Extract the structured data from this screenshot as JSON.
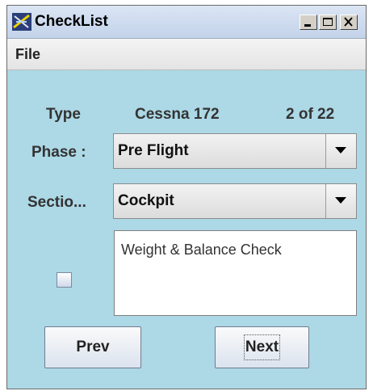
{
  "window": {
    "title": "CheckList",
    "controls": {
      "minimize": "minimize-icon",
      "maximize": "maximize-icon",
      "close": "close-icon"
    }
  },
  "menu": {
    "file": "File"
  },
  "header": {
    "type_label": "Type",
    "aircraft": "Cessna 172",
    "position": "2 of 22"
  },
  "phase": {
    "label": "Phase :",
    "selected": "Pre Flight"
  },
  "section": {
    "label": "Sectio...",
    "selected": "Cockpit"
  },
  "item": {
    "checked": false,
    "text": "Weight & Balance Check"
  },
  "buttons": {
    "prev": "Prev",
    "next": "Next"
  },
  "colors": {
    "background": "#add8e6"
  }
}
